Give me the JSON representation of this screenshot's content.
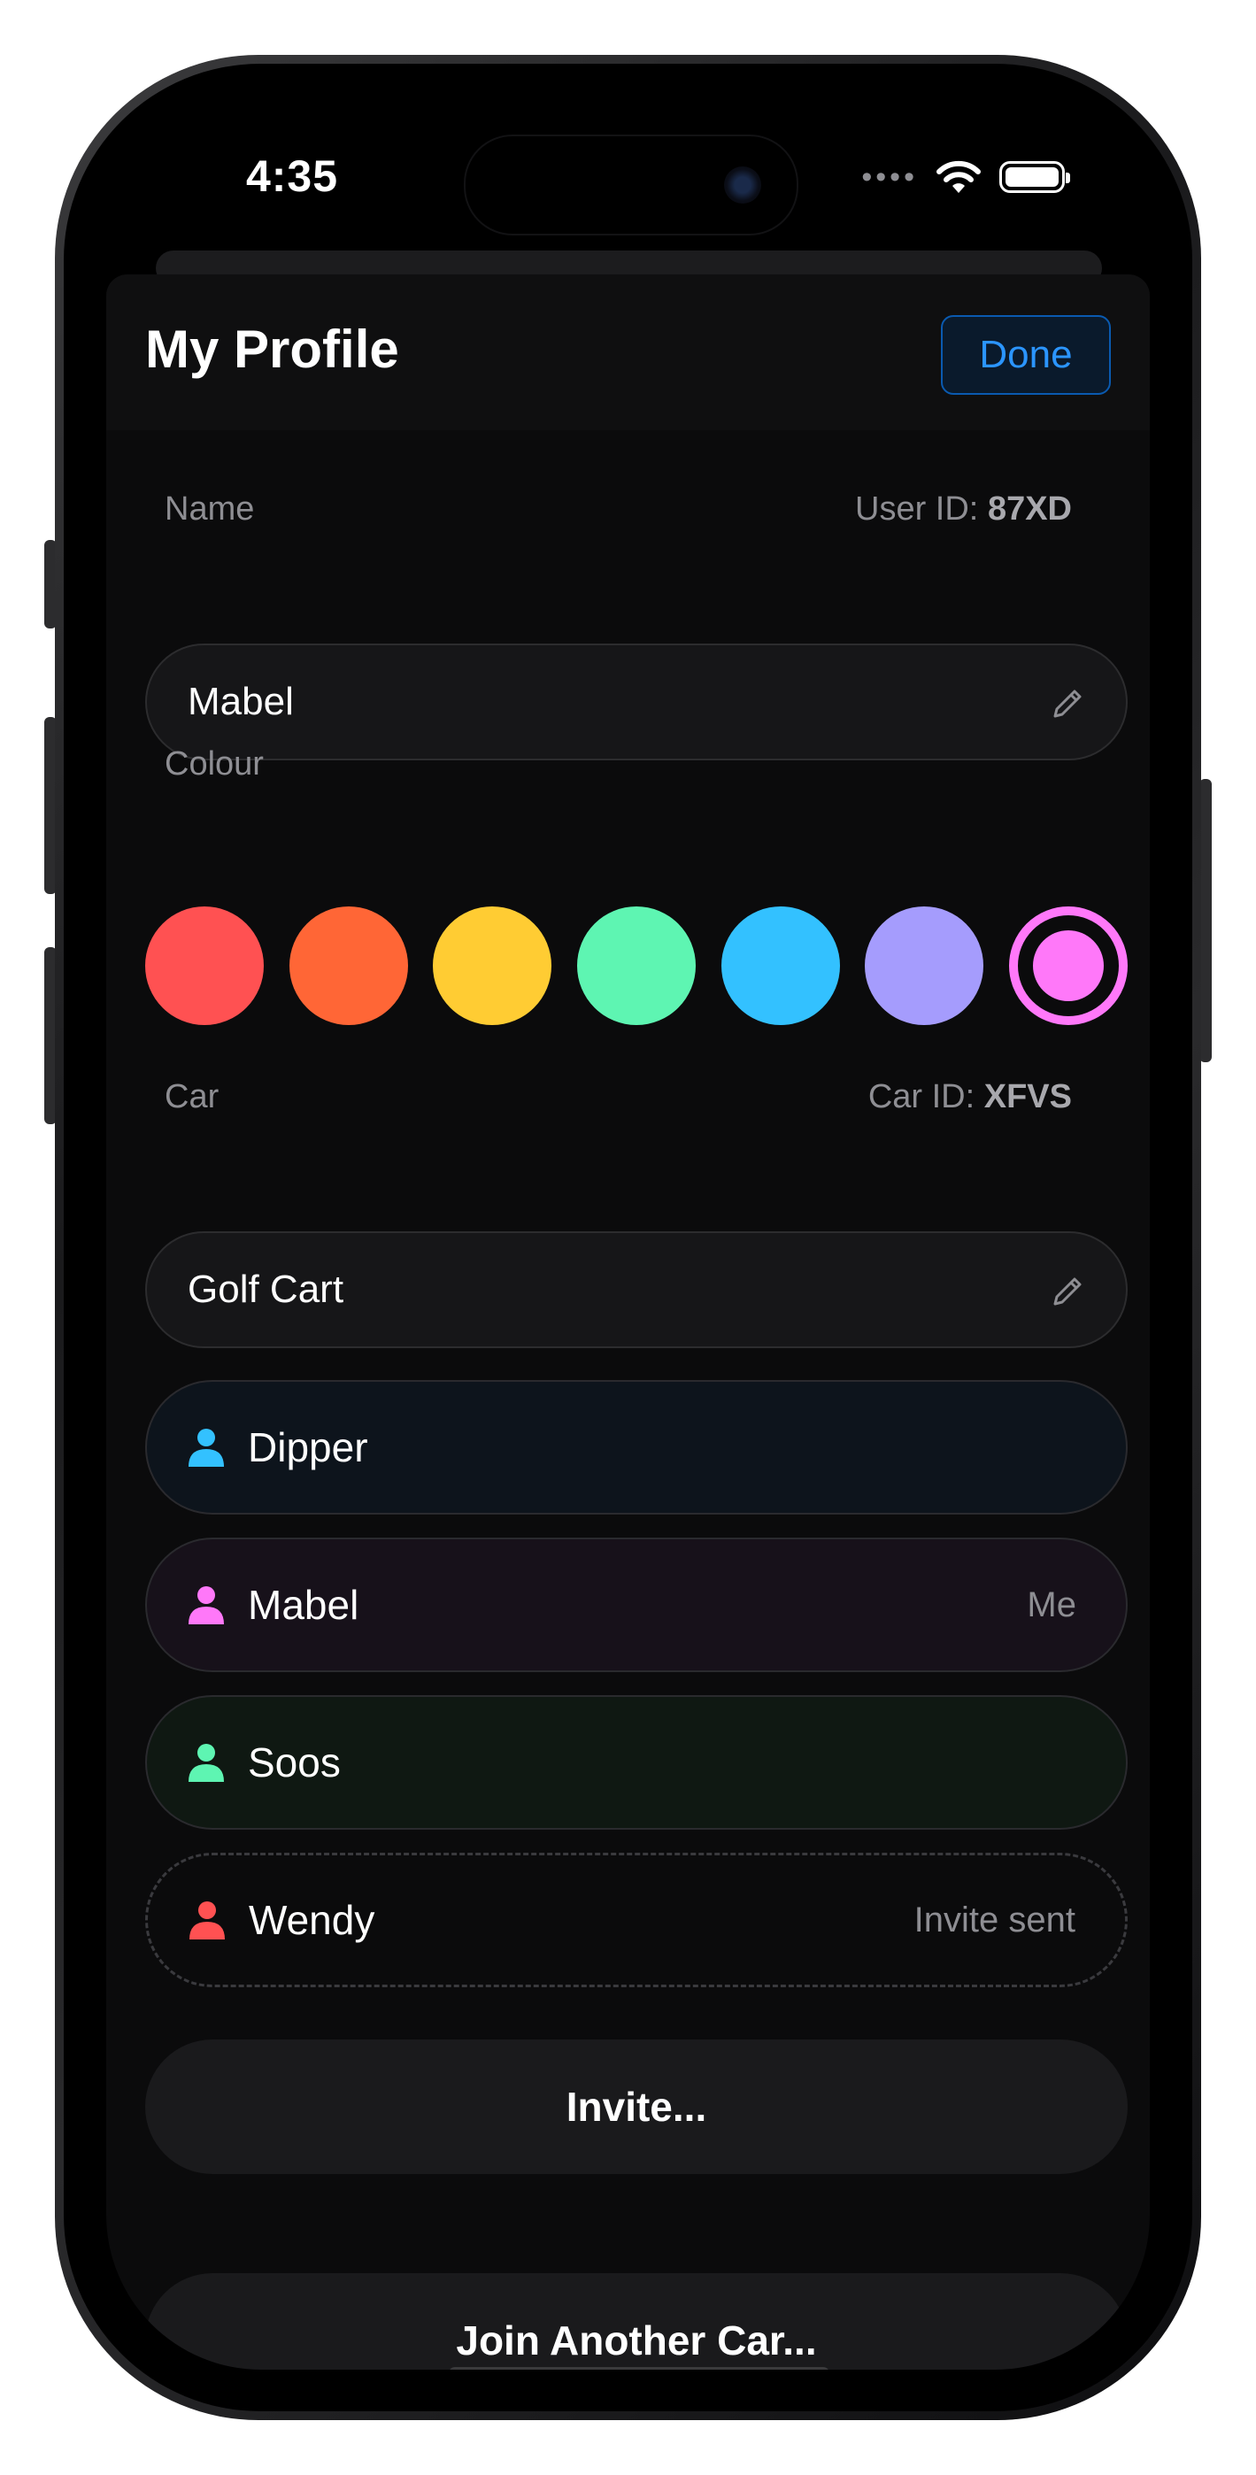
{
  "status_bar": {
    "time": "4:35"
  },
  "header": {
    "title": "My Profile",
    "done_label": "Done"
  },
  "name_section": {
    "label": "Name",
    "user_id_prefix": "User ID:",
    "user_id": "87XD",
    "value": "Mabel"
  },
  "colour_section": {
    "label": "Colour",
    "swatches": [
      "#ff5152",
      "#ff6636",
      "#ffcc33",
      "#5ef5b2",
      "#33c1ff",
      "#a59cfd",
      "#ff78f9"
    ],
    "selected": "#ff78f9"
  },
  "car_section": {
    "label": "Car",
    "car_id_prefix": "Car ID:",
    "car_id": "XFVS",
    "value": "Golf Cart"
  },
  "members": [
    {
      "name": "Dipper",
      "tag": "",
      "color": "#33c1ff",
      "bg": "#0d141c",
      "icon": "person-icon"
    },
    {
      "name": "Mabel",
      "tag": "Me",
      "color": "#ff78f9",
      "bg": "#17111a",
      "icon": "person-icon"
    },
    {
      "name": "Soos",
      "tag": "",
      "color": "#5ef5b2",
      "bg": "#0f1812",
      "icon": "person-icon"
    },
    {
      "name": "Wendy",
      "tag": "Invite sent",
      "color": "#ff5152",
      "bg": "",
      "icon": "person-icon"
    }
  ],
  "actions": {
    "invite_label": "Invite...",
    "join_label": "Join Another Car..."
  },
  "icons": {
    "edit": "pencil-icon",
    "wifi": "wifi-icon",
    "battery": "battery-icon",
    "signal": "signal-dots-icon"
  }
}
